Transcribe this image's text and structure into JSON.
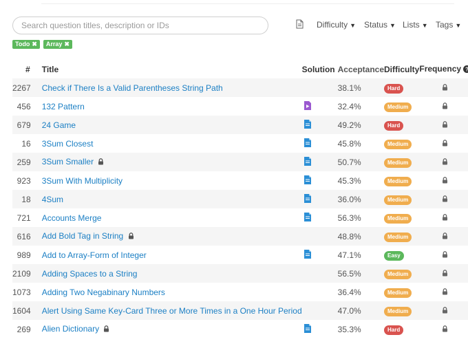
{
  "search": {
    "placeholder": "Search question titles, description or IDs",
    "value": ""
  },
  "filters": {
    "difficulty": "Difficulty",
    "status": "Status",
    "lists": "Lists",
    "tags": "Tags"
  },
  "active_tags": [
    "Todo",
    "Array"
  ],
  "table": {
    "headers": {
      "id": "#",
      "title": "Title",
      "solution": "Solution",
      "acceptance": "Acceptance",
      "difficulty": "Difficulty",
      "frequency": "Frequency"
    },
    "rows": [
      {
        "id": "2267",
        "title": "Check if There Is a Valid Parentheses String Path",
        "locked": false,
        "solution": "none",
        "acceptance": "38.1%",
        "difficulty": "Hard"
      },
      {
        "id": "456",
        "title": "132 Pattern",
        "locked": false,
        "solution": "video",
        "acceptance": "32.4%",
        "difficulty": "Medium"
      },
      {
        "id": "679",
        "title": "24 Game",
        "locked": false,
        "solution": "article",
        "acceptance": "49.2%",
        "difficulty": "Hard"
      },
      {
        "id": "16",
        "title": "3Sum Closest",
        "locked": false,
        "solution": "article",
        "acceptance": "45.8%",
        "difficulty": "Medium"
      },
      {
        "id": "259",
        "title": "3Sum Smaller",
        "locked": true,
        "solution": "article",
        "acceptance": "50.7%",
        "difficulty": "Medium"
      },
      {
        "id": "923",
        "title": "3Sum With Multiplicity",
        "locked": false,
        "solution": "article",
        "acceptance": "45.3%",
        "difficulty": "Medium"
      },
      {
        "id": "18",
        "title": "4Sum",
        "locked": false,
        "solution": "article",
        "acceptance": "36.0%",
        "difficulty": "Medium"
      },
      {
        "id": "721",
        "title": "Accounts Merge",
        "locked": false,
        "solution": "article",
        "acceptance": "56.3%",
        "difficulty": "Medium"
      },
      {
        "id": "616",
        "title": "Add Bold Tag in String",
        "locked": true,
        "solution": "none",
        "acceptance": "48.8%",
        "difficulty": "Medium"
      },
      {
        "id": "989",
        "title": "Add to Array-Form of Integer",
        "locked": false,
        "solution": "article",
        "acceptance": "47.1%",
        "difficulty": "Easy"
      },
      {
        "id": "2109",
        "title": "Adding Spaces to a String",
        "locked": false,
        "solution": "none",
        "acceptance": "56.5%",
        "difficulty": "Medium"
      },
      {
        "id": "1073",
        "title": "Adding Two Negabinary Numbers",
        "locked": false,
        "solution": "none",
        "acceptance": "36.4%",
        "difficulty": "Medium"
      },
      {
        "id": "1604",
        "title": "Alert Using Same Key-Card Three or More Times in a One Hour Period",
        "locked": false,
        "solution": "none",
        "acceptance": "47.0%",
        "difficulty": "Medium"
      },
      {
        "id": "269",
        "title": "Alien Dictionary",
        "locked": true,
        "solution": "article",
        "acceptance": "35.3%",
        "difficulty": "Hard"
      }
    ]
  },
  "colors": {
    "link": "#1b7fc4",
    "hard": "#d9534f",
    "medium": "#f0ad4e",
    "easy": "#5cb85c",
    "video": "#9b59d0",
    "article": "#2b8fd6"
  },
  "icons": {
    "solution_article": "doc-icon",
    "solution_video": "video-doc-icon",
    "frequency": "lock-icon"
  }
}
